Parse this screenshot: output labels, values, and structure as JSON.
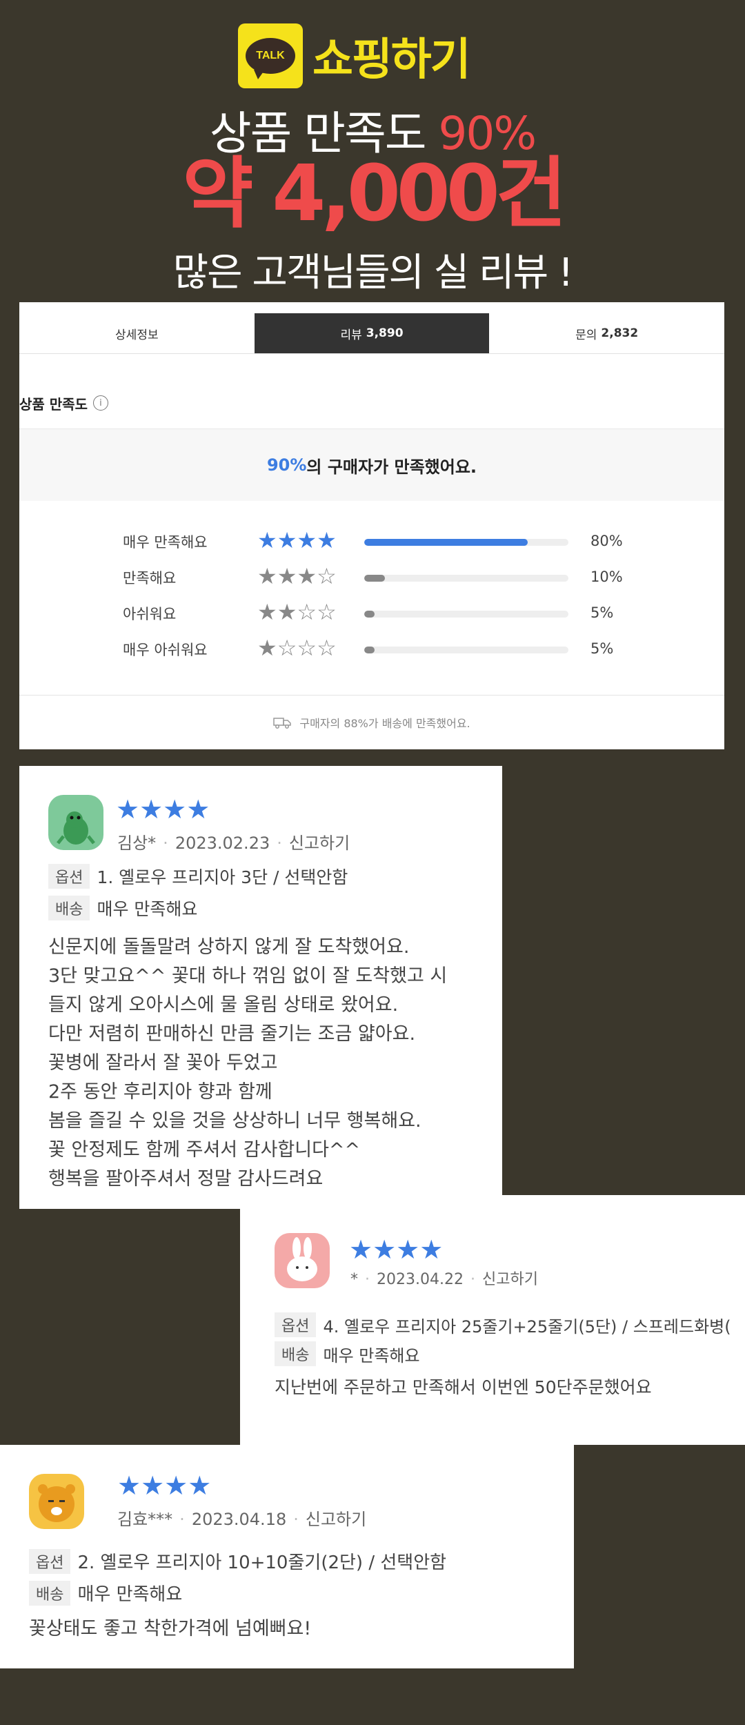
{
  "hero": {
    "badge_text": "TALK",
    "brand": "쇼핑하기",
    "line1_prefix": "상품 만족도 ",
    "line1_pct": "90%",
    "line2": "약 4,000건",
    "line3": "많은 고객님들의 실 리뷰 !"
  },
  "tabs": [
    {
      "label": "상세정보",
      "count": ""
    },
    {
      "label": "리뷰",
      "count": "3,890"
    },
    {
      "label": "문의",
      "count": "2,832"
    }
  ],
  "satisfaction": {
    "title": "상품 만족도",
    "info_glyph": "i",
    "highlight": "90%",
    "summary_suffix": "의 구매자가 만족했어요.",
    "rows": [
      {
        "label": "매우 만족해요",
        "stars": "★★★★",
        "pct_text": "80%",
        "fill": 0.8
      },
      {
        "label": "만족해요",
        "stars": "★★★☆",
        "pct_text": "10%",
        "fill": 0.1
      },
      {
        "label": "아쉬워요",
        "stars": "★★☆☆",
        "pct_text": "5%",
        "fill": 0.05
      },
      {
        "label": "매우 아쉬워요",
        "stars": "★☆☆☆",
        "pct_text": "5%",
        "fill": 0.05
      }
    ],
    "delivery_note": "구매자의 88%가 배송에 만족했어요."
  },
  "reviews": [
    {
      "stars": "★★★★",
      "author": "김상*",
      "date": "2023.02.23",
      "report": "신고하기",
      "option_tag": "옵션",
      "option": "1. 옐로우 프리지아 3단 / 선택안함",
      "delivery_tag": "배송",
      "delivery": "매우 만족해요",
      "body": "신문지에 돌돌말려 상하지 않게 잘 도착했어요.\n3단 맞고요^^ 꽃대 하나 꺾임 없이 잘 도착했고 시\n들지 않게 오아시스에 물 올림 상태로 왔어요.\n다만 저렴히 판매하신 만큼 줄기는 조금 얇아요.\n꽃병에 잘라서 잘 꽃아 두었고\n2주 동안 후리지아 향과 함께\n봄을 즐길 수 있을 것을 상상하니 너무 행복해요.\n꽃 안정제도 함께 주셔서 감사합니다^^\n행복을 팔아주셔서 정말 감사드려요"
    },
    {
      "stars": "★★★★",
      "author": "*",
      "date": "2023.04.22",
      "report": "신고하기",
      "option_tag": "옵션",
      "option": "4. 옐로우 프리지아 25줄기+25줄기(5단) / 스프레드화병(",
      "delivery_tag": "배송",
      "delivery": "매우 만족해요",
      "body": "지난번에 주문하고 만족해서 이번엔 50단주문했어요"
    },
    {
      "stars": "★★★★",
      "author": "김효***",
      "date": "2023.04.18",
      "report": "신고하기",
      "option_tag": "옵션",
      "option": "2. 옐로우 프리지아 10+10줄기(2단) / 선택안함",
      "delivery_tag": "배송",
      "delivery": "매우 만족해요",
      "body": "꽃상태도 좋고 착한가격에 넘예뻐요!"
    }
  ],
  "colors": {
    "background": "#3b372c",
    "accent_blue": "#3d7de1",
    "accent_red": "#ef4b4b",
    "kakao_yellow": "#f5e21b"
  },
  "icons": [
    "kakao-talk-icon",
    "info-icon",
    "truck-icon",
    "dinosaur-avatar-icon",
    "rabbit-avatar-icon",
    "lion-avatar-icon"
  ]
}
